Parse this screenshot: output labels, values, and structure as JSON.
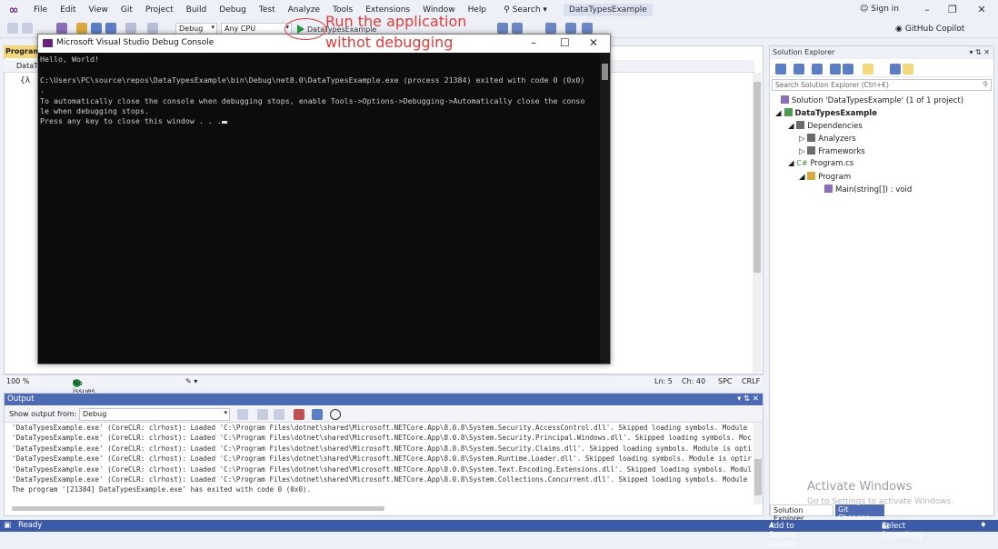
{
  "menubar": {
    "items": [
      "File",
      "Edit",
      "View",
      "Git",
      "Project",
      "Build",
      "Debug",
      "Test",
      "Analyze",
      "Tools",
      "Extensions",
      "Window",
      "Help"
    ],
    "search_label": "Search",
    "project_name": "DataTypesExample",
    "sign_in": "Sign in"
  },
  "toolbar": {
    "config": "Debug",
    "platform": "Any CPU",
    "run_target": "DataTypesExample",
    "copilot": "GitHub Copilot"
  },
  "annotation": {
    "line1": "Run the application",
    "line2": "withot debugging"
  },
  "console": {
    "title": "Microsoft Visual Studio Debug Console",
    "lines": [
      "Hello, World!",
      "",
      "C:\\Users\\PC\\source\\repos\\DataTypesExample\\bin\\Debug\\net8.0\\DataTypesExample.exe (process 21384) exited with code 0 (0x0)",
      ".",
      "To automatically close the console when debugging stops, enable Tools->Options->Debugging->Automatically close the conso",
      "le when debugging stops.",
      "Press any key to close this window . . ."
    ]
  },
  "editor": {
    "tab_label": "Program",
    "nav_label": "DataT",
    "status": {
      "zoom": "100 %",
      "issues": "No issues found",
      "line": "Ln: 5",
      "col": "Ch: 40",
      "spc": "SPC",
      "eol": "CRLF"
    }
  },
  "solution_explorer": {
    "title": "Solution Explorer",
    "search_placeholder": "Search Solution Explorer (Ctrl+€)",
    "tree": {
      "solution": "Solution 'DataTypesExample' (1 of 1 project)",
      "project": "DataTypesExample",
      "dependencies": "Dependencies",
      "analyzers": "Analyzers",
      "frameworks": "Frameworks",
      "program_cs": "Program.cs",
      "program_class": "Program",
      "main_method": "Main(string[]) : void"
    },
    "tabs": [
      "Solution Explorer",
      "Git Changes"
    ]
  },
  "output": {
    "title": "Output",
    "show_from_label": "Show output from:",
    "show_from_value": "Debug",
    "lines": [
      "'DataTypesExample.exe' (CoreCLR: clrhost): Loaded 'C:\\Program Files\\dotnet\\shared\\Microsoft.NETCore.App\\8.0.8\\System.Security.AccessControl.dll'. Skipped loading symbols. Module",
      "'DataTypesExample.exe' (CoreCLR: clrhost): Loaded 'C:\\Program Files\\dotnet\\shared\\Microsoft.NETCore.App\\8.0.8\\System.Security.Principal.Windows.dll'. Skipped loading symbols. Moc",
      "'DataTypesExample.exe' (CoreCLR: clrhost): Loaded 'C:\\Program Files\\dotnet\\shared\\Microsoft.NETCore.App\\8.0.8\\System.Security.Claims.dll'. Skipped loading symbols. Module is opti",
      "'DataTypesExample.exe' (CoreCLR: clrhost): Loaded 'C:\\Program Files\\dotnet\\shared\\Microsoft.NETCore.App\\8.0.8\\System.Runtime.Loader.dll'. Skipped loading symbols. Module is optir",
      "'DataTypesExample.exe' (CoreCLR: clrhost): Loaded 'C:\\Program Files\\dotnet\\shared\\Microsoft.NETCore.App\\8.0.8\\System.Text.Encoding.Extensions.dll'. Skipped loading symbols. Modul",
      "'DataTypesExample.exe' (CoreCLR: clrhost): Loaded 'C:\\Program Files\\dotnet\\shared\\Microsoft.NETCore.App\\8.0.8\\System.Collections.Concurrent.dll'. Skipped loading symbols. Module",
      "The program '[21384] DataTypesExample.exe' has exited with code 0 (0x0)."
    ]
  },
  "statusbar": {
    "ready": "Ready",
    "add_source": "Add to Source Control",
    "select_repo": "Select Repository"
  },
  "watermark": {
    "line1": "Activate Windows",
    "line2": "Go to Settings to activate Windows."
  },
  "colors": {
    "accent": "#3b5aa8",
    "annotation": "#e53935",
    "run_green": "#1f9b36",
    "console_bg": "#0c0c0c"
  }
}
